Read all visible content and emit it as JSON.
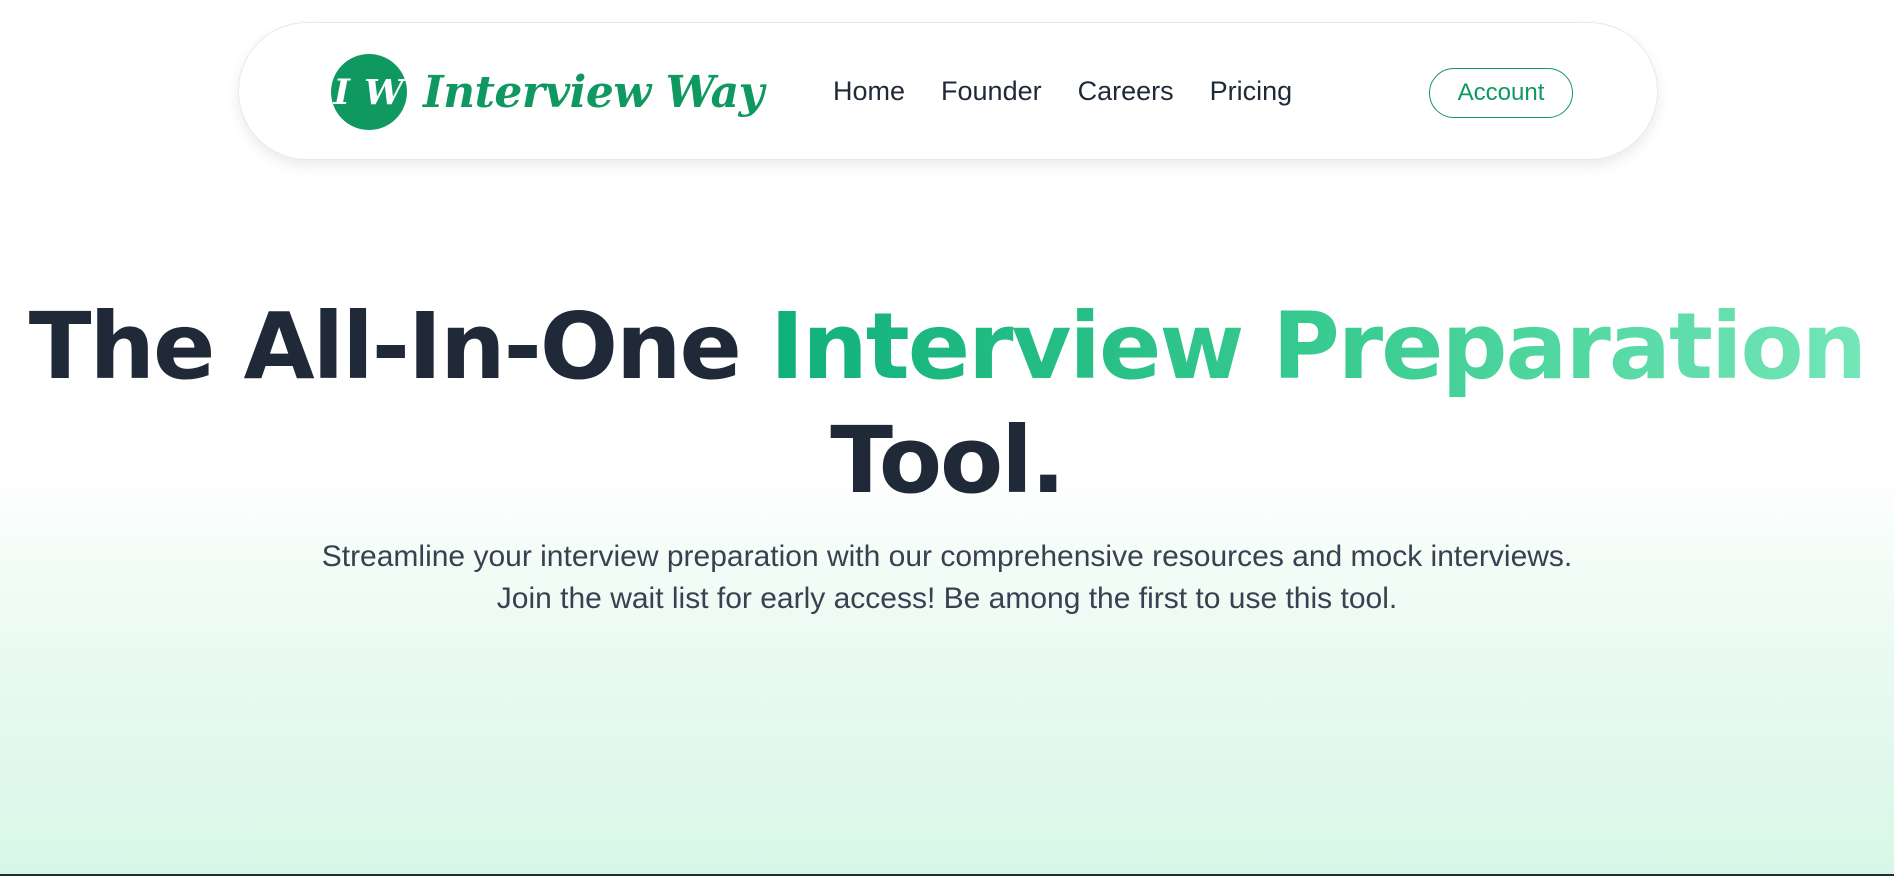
{
  "brand": {
    "logo_text": "I W",
    "name": "Interview Way",
    "primary_color": "#0f9961"
  },
  "nav": {
    "links": [
      {
        "label": "Home"
      },
      {
        "label": "Founder"
      },
      {
        "label": "Careers"
      },
      {
        "label": "Pricing"
      }
    ],
    "account_label": "Account"
  },
  "hero": {
    "title_part1": "The All-In-One ",
    "title_accent": "Interview Preparation",
    "title_part2": " Tool.",
    "subtitle_line1": "Streamline your interview preparation with our comprehensive resources and mock interviews.",
    "subtitle_line2": "Join the wait list for early access! Be among the first to use this tool.",
    "accent_gradient": [
      "#10b07a",
      "#74e6b8"
    ]
  }
}
